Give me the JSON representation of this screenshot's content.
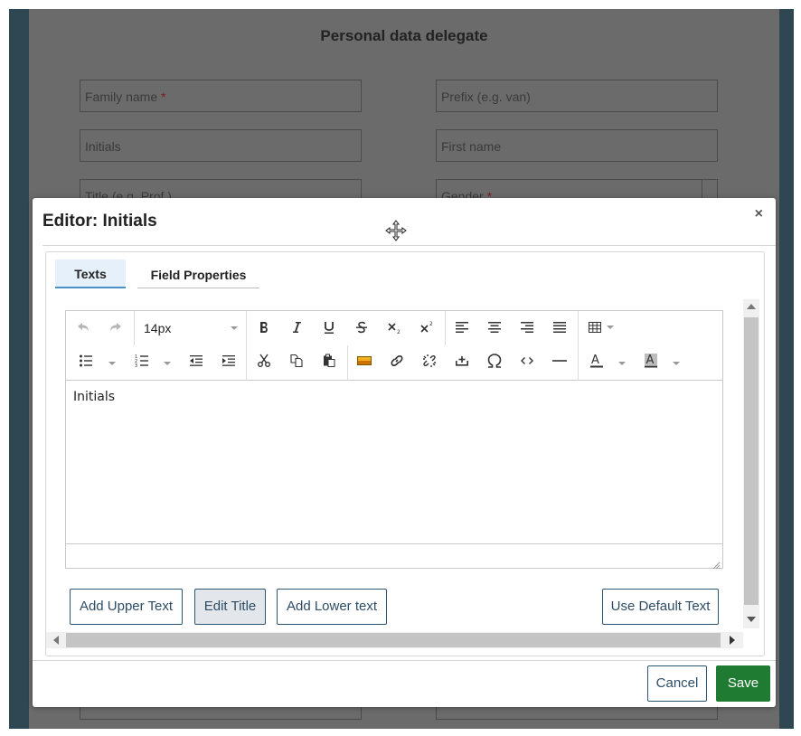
{
  "background": {
    "title": "Personal data delegate",
    "fields": {
      "family_name": "Family name",
      "required_mark": "*",
      "prefix": "Prefix (e.g. van)",
      "initials": "Initials",
      "first_name": "First name",
      "title": "Title (e.g. Prof.)",
      "gender": "Gender"
    }
  },
  "modal": {
    "title": "Editor: Initials",
    "close_label": "×",
    "tabs": [
      {
        "label": "Texts",
        "active": true
      },
      {
        "label": "Field Properties",
        "active": false
      }
    ],
    "toolbar": {
      "font_size": "14px"
    },
    "editor_content": "Initials",
    "buttons": {
      "add_upper": "Add Upper Text",
      "edit_title": "Edit Title",
      "add_lower": "Add Lower text",
      "use_default": "Use Default Text"
    },
    "footer": {
      "cancel": "Cancel",
      "save": "Save"
    }
  },
  "colors": {
    "save_green": "#1f7a32",
    "button_border": "#2d5470",
    "tab_active_bg": "#e6f0fa",
    "backdrop": "#6b6b6b",
    "frame": "#2e4752"
  }
}
